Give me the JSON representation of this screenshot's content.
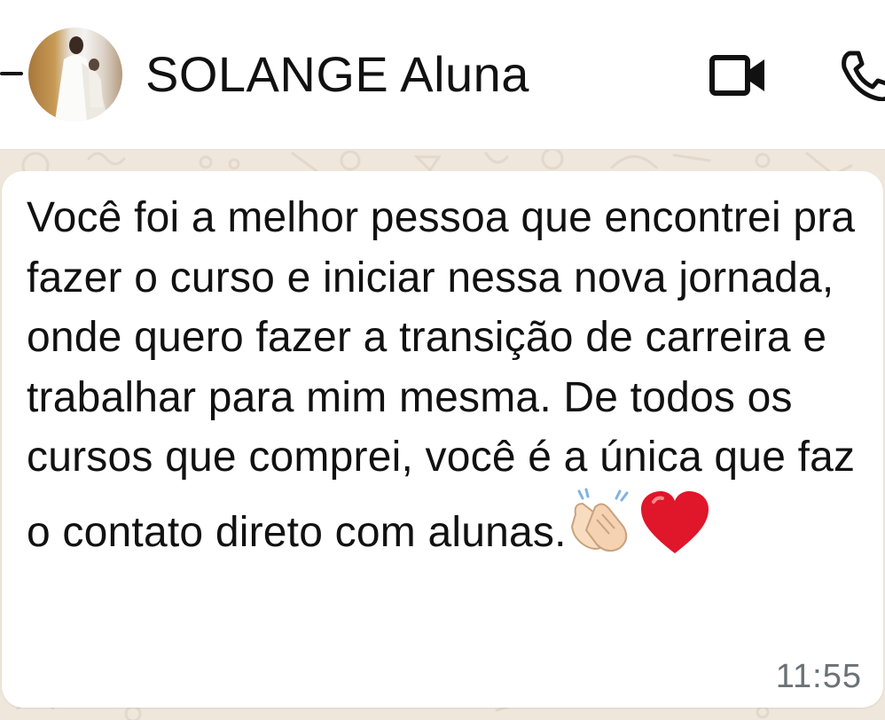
{
  "header": {
    "contact_name": "SOLANGE Aluna",
    "icons": {
      "back": "back-arrow-icon",
      "video": "video-camera-icon",
      "call": "phone-icon"
    }
  },
  "message": {
    "text": "Você foi a melhor pessoa que encontrei pra fazer o curso e iniciar nessa nova jornada, onde quero fazer a transição de carreira e trabalhar para mim mesma. De todos os cursos que comprei, você é a única que faz o contato direto com alunas.",
    "emojis": [
      "clapping-hands-icon",
      "red-heart-icon"
    ],
    "time": "11:55"
  },
  "colors": {
    "chat_background": "#efe7dc",
    "bubble": "#ffffff",
    "heart": "#e0162b",
    "time_text": "#6b7276"
  }
}
